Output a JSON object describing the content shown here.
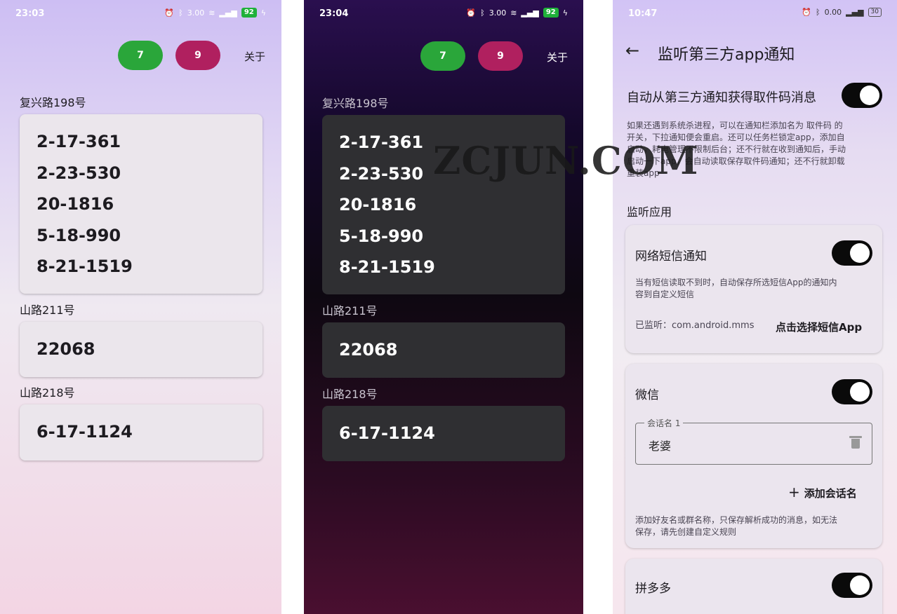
{
  "phone1": {
    "time": "23:03",
    "battery": "92",
    "net_speed": "3.00",
    "pill_green": "7",
    "pill_pink": "9",
    "about": "关于",
    "groups": [
      {
        "label": "复兴路198号",
        "codes": [
          "2-17-361",
          "2-23-530",
          "20-1816",
          "5-18-990",
          "8-21-1519"
        ]
      },
      {
        "label": "山路211号",
        "codes": [
          "22068"
        ]
      },
      {
        "label": "山路218号",
        "codes": [
          "6-17-1124"
        ]
      }
    ]
  },
  "phone2": {
    "time": "23:04",
    "battery": "92",
    "net_speed": "3.00",
    "pill_green": "7",
    "pill_pink": "9",
    "about": "关于",
    "groups": [
      {
        "label": "复兴路198号",
        "codes": [
          "2-17-361",
          "2-23-530",
          "20-1816",
          "5-18-990",
          "8-21-1519"
        ]
      },
      {
        "label": "山路211号",
        "codes": [
          "22068"
        ]
      },
      {
        "label": "山路218号",
        "codes": [
          "6-17-1124"
        ]
      }
    ]
  },
  "phone3": {
    "time": "10:47",
    "battery": "30",
    "net_speed": "0.00",
    "title": "监听第三方app通知",
    "auto_label": "自动从第三方通知获得取件码消息",
    "auto_desc_1": "如果还遇到系统杀进程，可以在通知栏添加名为 取件码 的",
    "auto_desc_2": "开关，下拉通知便会重启。还可以任务栏锁定app，添加自",
    "auto_desc_3": "启动，耗电管理不限制后台；还不行就在收到通知后，手动",
    "auto_desc_4": "启动一下app，会自动读取保存取件码通知；还不行就卸载",
    "auto_desc_5": "重装app",
    "section_title": "监听应用",
    "sms": {
      "title": "网络短信通知",
      "desc_1": "当有短信读取不到时，自动保存所选短信App的通知内",
      "desc_2": "容到自定义短信",
      "listening": "已监听：com.android.mms",
      "select": "点击选择短信App"
    },
    "wechat": {
      "title": "微信",
      "field_label": "会话名 1",
      "field_value": "老婆",
      "add": "添加会话名",
      "desc_1": "添加好友名或群名称，只保存解析成功的消息，如无法",
      "desc_2": "保存，请先创建自定义规则"
    },
    "pdd": {
      "title": "拼多多"
    }
  },
  "watermark": "ZCJUN.COM",
  "colors": {
    "green": "#2aa63a",
    "pink": "#b0205f",
    "toggle": "#0a0a0a"
  }
}
